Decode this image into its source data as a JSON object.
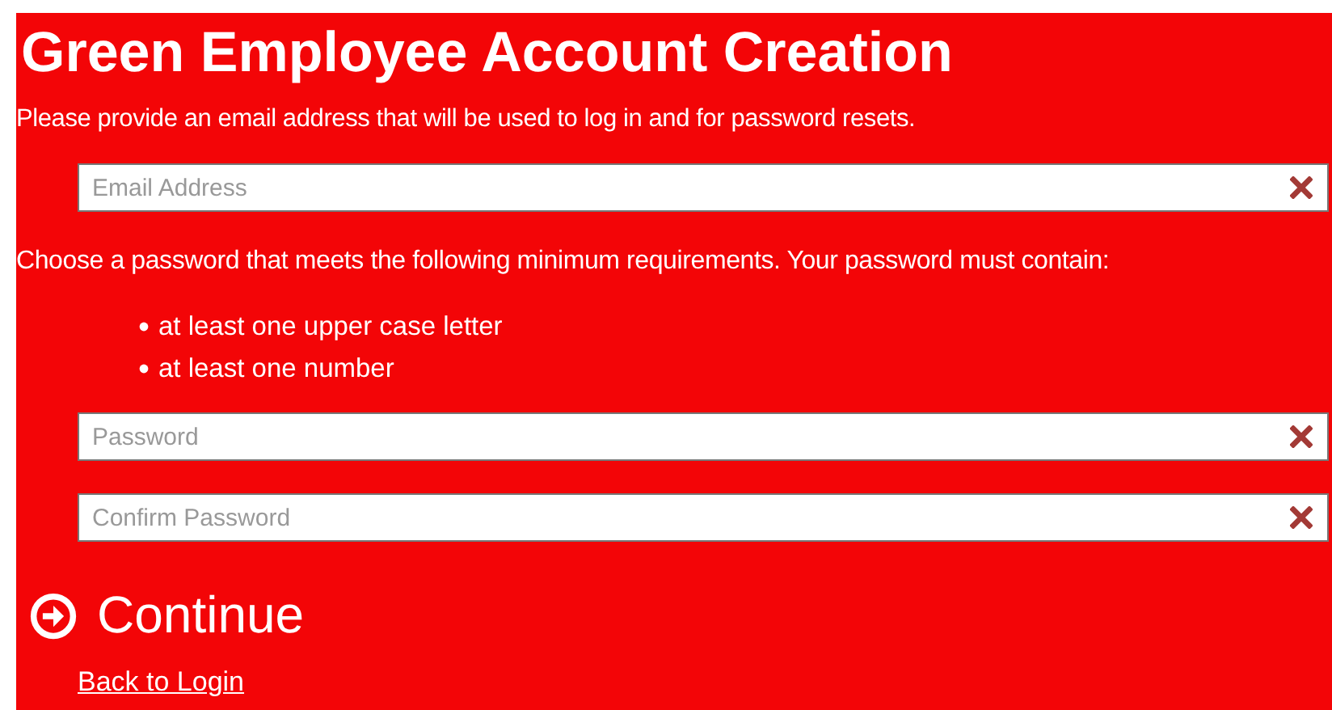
{
  "form": {
    "title": "Green Employee Account Creation",
    "intro": "Please provide an email address that will be used to log in and for password resets.",
    "email_field": {
      "placeholder": "Email Address"
    },
    "requirements_intro": "Choose a password that meets the following minimum requirements. Your password must contain:",
    "requirements": [
      "at least one upper case letter",
      "at least one number"
    ],
    "password_fields": [
      {
        "placeholder": "Password"
      },
      {
        "placeholder": "Confirm Password"
      }
    ],
    "continue_button": "Continue",
    "back_link": "Back to Login"
  }
}
